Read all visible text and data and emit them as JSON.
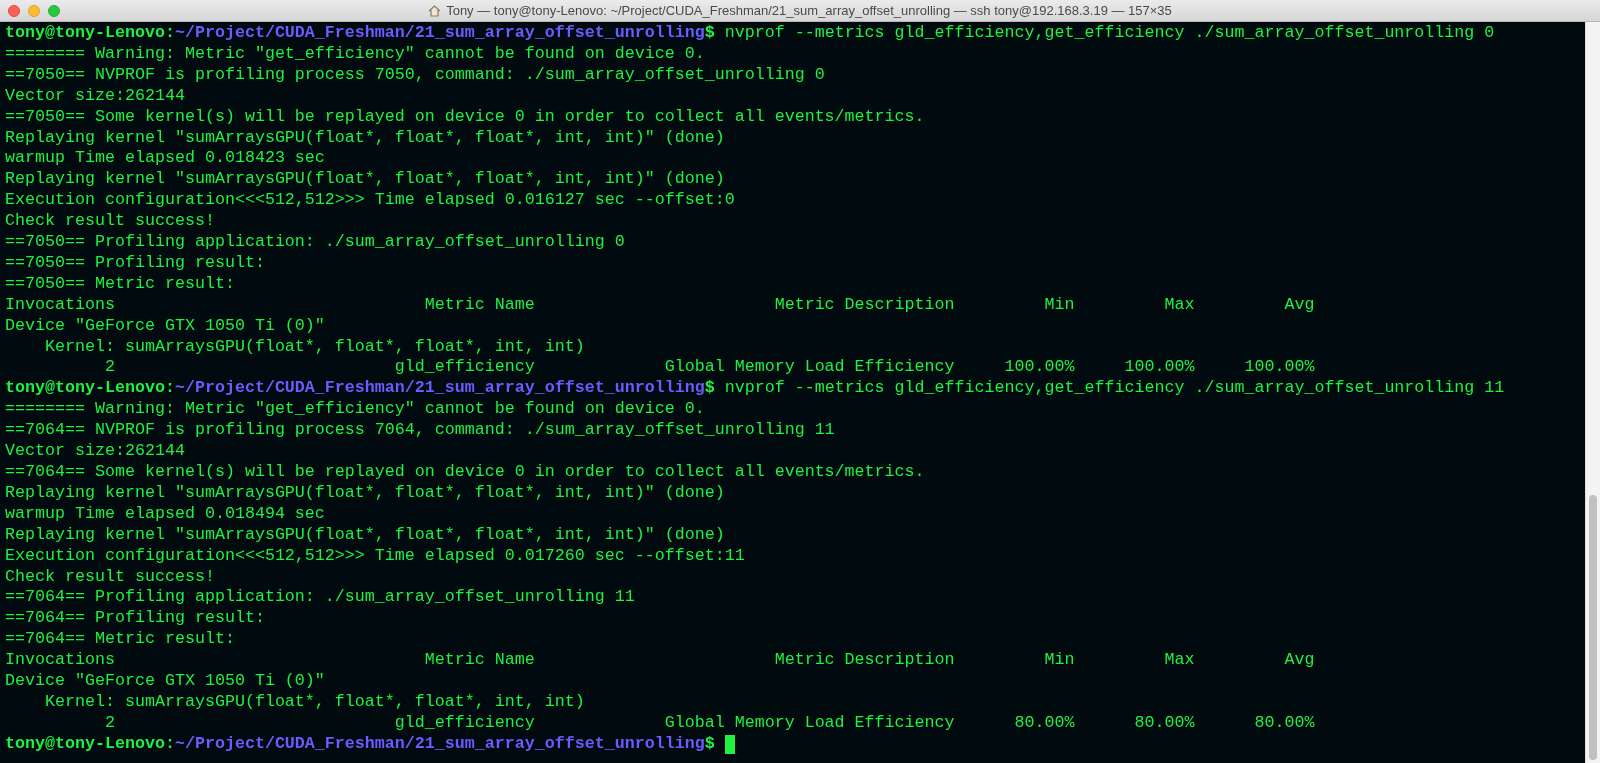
{
  "window": {
    "title": "Tony — tony@tony-Lenovo: ~/Project/CUDA_Freshman/21_sum_array_offset_unrolling — ssh tony@192.168.3.19 — 157×35"
  },
  "lines": [
    {
      "kind": "prompt",
      "user_host": "tony@tony-Lenovo:",
      "path": "~/Project/CUDA_Freshman/21_sum_array_offset_unrolling",
      "symbol": "$",
      "command": "nvprof --metrics gld_efficiency,get_efficiency ./sum_array_offset_unrolling 0",
      "cursor": false
    },
    {
      "kind": "output",
      "text": "======== Warning: Metric \"get_efficiency\" cannot be found on device 0."
    },
    {
      "kind": "output",
      "text": "==7050== NVPROF is profiling process 7050, command: ./sum_array_offset_unrolling 0"
    },
    {
      "kind": "output",
      "text": "Vector size:262144"
    },
    {
      "kind": "output",
      "text": "==7050== Some kernel(s) will be replayed on device 0 in order to collect all events/metrics."
    },
    {
      "kind": "output",
      "text": "Replaying kernel \"sumArraysGPU(float*, float*, float*, int, int)\" (done)"
    },
    {
      "kind": "output",
      "text": "warmup Time elapsed 0.018423 sec"
    },
    {
      "kind": "output",
      "text": "Replaying kernel \"sumArraysGPU(float*, float*, float*, int, int)\" (done)"
    },
    {
      "kind": "output",
      "text": "Execution configuration<<<512,512>>> Time elapsed 0.016127 sec --offset:0"
    },
    {
      "kind": "output",
      "text": "Check result success!"
    },
    {
      "kind": "output",
      "text": "==7050== Profiling application: ./sum_array_offset_unrolling 0"
    },
    {
      "kind": "output",
      "text": "==7050== Profiling result:"
    },
    {
      "kind": "output",
      "text": "==7050== Metric result:"
    },
    {
      "kind": "output",
      "text": "Invocations                               Metric Name                        Metric Description         Min         Max         Avg"
    },
    {
      "kind": "output",
      "text": "Device \"GeForce GTX 1050 Ti (0)\""
    },
    {
      "kind": "output",
      "text": "    Kernel: sumArraysGPU(float*, float*, float*, int, int)"
    },
    {
      "kind": "output",
      "text": "          2                            gld_efficiency             Global Memory Load Efficiency     100.00%     100.00%     100.00%"
    },
    {
      "kind": "prompt",
      "user_host": "tony@tony-Lenovo:",
      "path": "~/Project/CUDA_Freshman/21_sum_array_offset_unrolling",
      "symbol": "$",
      "command": "nvprof --metrics gld_efficiency,get_efficiency ./sum_array_offset_unrolling 11",
      "cursor": false
    },
    {
      "kind": "output",
      "text": "======== Warning: Metric \"get_efficiency\" cannot be found on device 0."
    },
    {
      "kind": "output",
      "text": "==7064== NVPROF is profiling process 7064, command: ./sum_array_offset_unrolling 11"
    },
    {
      "kind": "output",
      "text": "Vector size:262144"
    },
    {
      "kind": "output",
      "text": "==7064== Some kernel(s) will be replayed on device 0 in order to collect all events/metrics."
    },
    {
      "kind": "output",
      "text": "Replaying kernel \"sumArraysGPU(float*, float*, float*, int, int)\" (done)"
    },
    {
      "kind": "output",
      "text": "warmup Time elapsed 0.018494 sec"
    },
    {
      "kind": "output",
      "text": "Replaying kernel \"sumArraysGPU(float*, float*, float*, int, int)\" (done)"
    },
    {
      "kind": "output",
      "text": "Execution configuration<<<512,512>>> Time elapsed 0.017260 sec --offset:11"
    },
    {
      "kind": "output",
      "text": "Check result success!"
    },
    {
      "kind": "output",
      "text": "==7064== Profiling application: ./sum_array_offset_unrolling 11"
    },
    {
      "kind": "output",
      "text": "==7064== Profiling result:"
    },
    {
      "kind": "output",
      "text": "==7064== Metric result:"
    },
    {
      "kind": "output",
      "text": "Invocations                               Metric Name                        Metric Description         Min         Max         Avg"
    },
    {
      "kind": "output",
      "text": "Device \"GeForce GTX 1050 Ti (0)\""
    },
    {
      "kind": "output",
      "text": "    Kernel: sumArraysGPU(float*, float*, float*, int, int)"
    },
    {
      "kind": "output",
      "text": "          2                            gld_efficiency             Global Memory Load Efficiency      80.00%      80.00%      80.00%"
    },
    {
      "kind": "prompt",
      "user_host": "tony@tony-Lenovo:",
      "path": "~/Project/CUDA_Freshman/21_sum_array_offset_unrolling",
      "symbol": "$",
      "cursor": true
    }
  ]
}
